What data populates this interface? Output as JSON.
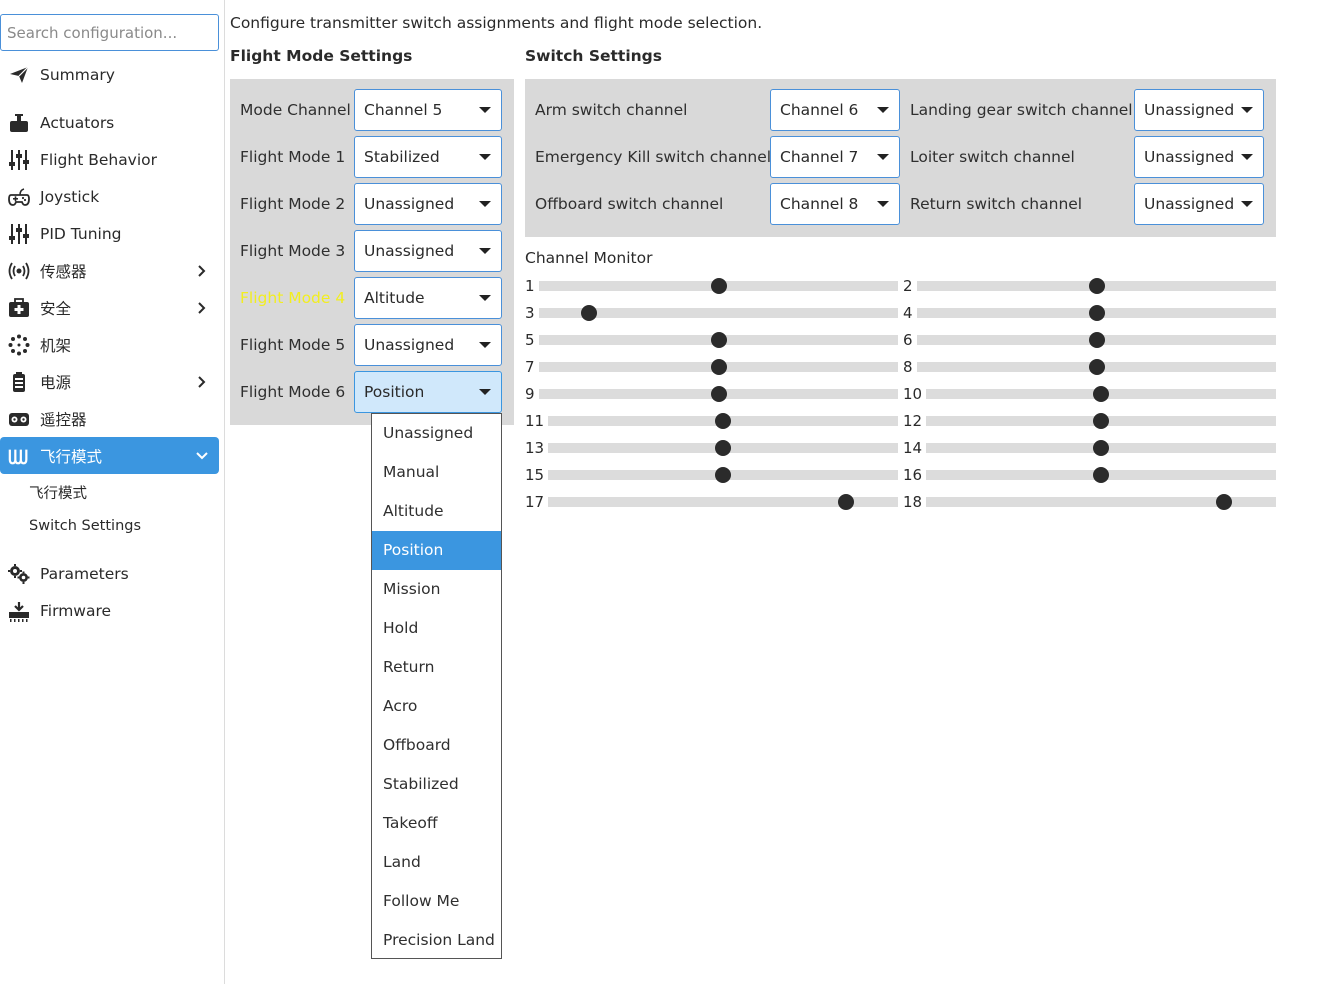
{
  "sidebar": {
    "search_placeholder": "Search configuration...",
    "items": [
      {
        "label": "Summary",
        "icon": "paper-plane-icon"
      },
      {
        "label": "Actuators",
        "icon": "motor-icon"
      },
      {
        "label": "Flight Behavior",
        "icon": "sliders-icon"
      },
      {
        "label": "Joystick",
        "icon": "gamepad-icon"
      },
      {
        "label": "PID Tuning",
        "icon": "sliders-icon"
      },
      {
        "label": "传感器",
        "icon": "radio-waves-icon",
        "has_children": true
      },
      {
        "label": "安全",
        "icon": "medkit-icon",
        "has_children": true
      },
      {
        "label": "机架",
        "icon": "airframe-icon"
      },
      {
        "label": "电源",
        "icon": "battery-icon",
        "has_children": true
      },
      {
        "label": "遥控器",
        "icon": "remote-control-icon"
      },
      {
        "label": "飞行模式",
        "icon": "flight-mode-icon",
        "expanded": true,
        "active": true
      },
      {
        "label": "Parameters",
        "icon": "gears-icon"
      },
      {
        "label": "Firmware",
        "icon": "firmware-icon"
      }
    ],
    "sub_items": [
      "飞行模式",
      "Switch Settings"
    ],
    "accent_color": "#3b96e0"
  },
  "main": {
    "intro": "Configure transmitter switch assignments and flight mode selection.",
    "flight_mode_settings": {
      "title": "Flight Mode Settings",
      "rows": [
        {
          "label": "Mode Channel",
          "value": "Channel 5"
        },
        {
          "label": "Flight Mode 1",
          "value": "Stabilized"
        },
        {
          "label": "Flight Mode 2",
          "value": "Unassigned"
        },
        {
          "label": "Flight Mode 3",
          "value": "Unassigned"
        },
        {
          "label": "Flight Mode 4",
          "value": "Altitude",
          "highlighted": true
        },
        {
          "label": "Flight Mode 5",
          "value": "Unassigned"
        },
        {
          "label": "Flight Mode 6",
          "value": "Position",
          "open": true
        }
      ],
      "highlight_color": "#f2ee20"
    },
    "switch_settings": {
      "title": "Switch Settings",
      "rows": [
        {
          "label": "Arm switch channel",
          "value": "Channel 6",
          "label2": "Landing gear switch channel",
          "value2": "Unassigned"
        },
        {
          "label": "Emergency Kill switch channel",
          "value": "Channel 7",
          "label2": "Loiter switch channel",
          "value2": "Unassigned"
        },
        {
          "label": "Offboard switch channel",
          "value": "Channel 8",
          "label2": "Return switch channel",
          "value2": "Unassigned"
        }
      ]
    },
    "channel_monitor": {
      "title": "Channel Monitor",
      "channels": [
        {
          "num": "1",
          "level": 0.5
        },
        {
          "num": "2",
          "level": 0.5
        },
        {
          "num": "3",
          "level": 0.14
        },
        {
          "num": "4",
          "level": 0.5
        },
        {
          "num": "5",
          "level": 0.5
        },
        {
          "num": "6",
          "level": 0.5
        },
        {
          "num": "7",
          "level": 0.5
        },
        {
          "num": "8",
          "level": 0.5
        },
        {
          "num": "9",
          "level": 0.5
        },
        {
          "num": "10",
          "level": 0.5
        },
        {
          "num": "11",
          "level": 0.5
        },
        {
          "num": "12",
          "level": 0.5
        },
        {
          "num": "13",
          "level": 0.5
        },
        {
          "num": "14",
          "level": 0.5
        },
        {
          "num": "15",
          "level": 0.5
        },
        {
          "num": "16",
          "level": 0.5
        },
        {
          "num": "17",
          "level": 0.85
        },
        {
          "num": "18",
          "level": 0.85
        }
      ]
    }
  },
  "dropdown": {
    "options": [
      "Unassigned",
      "Manual",
      "Altitude",
      "Position",
      "Mission",
      "Hold",
      "Return",
      "Acro",
      "Offboard",
      "Stabilized",
      "Takeoff",
      "Land",
      "Follow Me",
      "Precision Land"
    ],
    "selected": "Position"
  }
}
